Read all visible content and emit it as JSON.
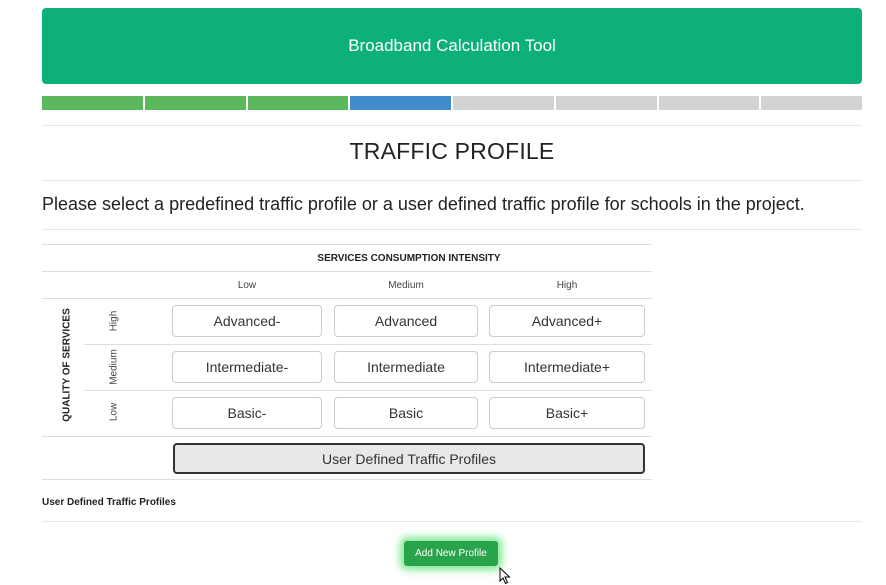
{
  "header": {
    "title": "Broadband Calculation Tool"
  },
  "progress": {
    "steps": [
      "done",
      "done",
      "done",
      "active",
      "todo",
      "todo",
      "todo",
      "todo"
    ]
  },
  "page": {
    "title": "TRAFFIC PROFILE",
    "instructions": "Please select a predefined traffic profile or a user defined traffic profile for schools in the project."
  },
  "profile_grid": {
    "intensity_title": "SERVICES CONSUMPTION INTENSITY",
    "quality_title": "QUALITY OF SERVICES",
    "columns": [
      "Low",
      "Medium",
      "High"
    ],
    "rows": [
      {
        "label": "High",
        "profiles": [
          "Advanced-",
          "Advanced",
          "Advanced+"
        ]
      },
      {
        "label": "Medium",
        "profiles": [
          "Intermediate-",
          "Intermediate",
          "Intermediate+"
        ]
      },
      {
        "label": "Low",
        "profiles": [
          "Basic-",
          "Basic",
          "Basic+"
        ]
      }
    ],
    "user_defined_button": "User Defined Traffic Profiles"
  },
  "user_defined_section": {
    "label": "User Defined Traffic Profiles",
    "add_button": "Add New Profile"
  },
  "colors": {
    "header_bg": "#0db07b",
    "step_done": "#5cb85c",
    "step_active": "#428bca",
    "step_todo": "#d3d3d3",
    "add_button": "#2aa44a"
  }
}
